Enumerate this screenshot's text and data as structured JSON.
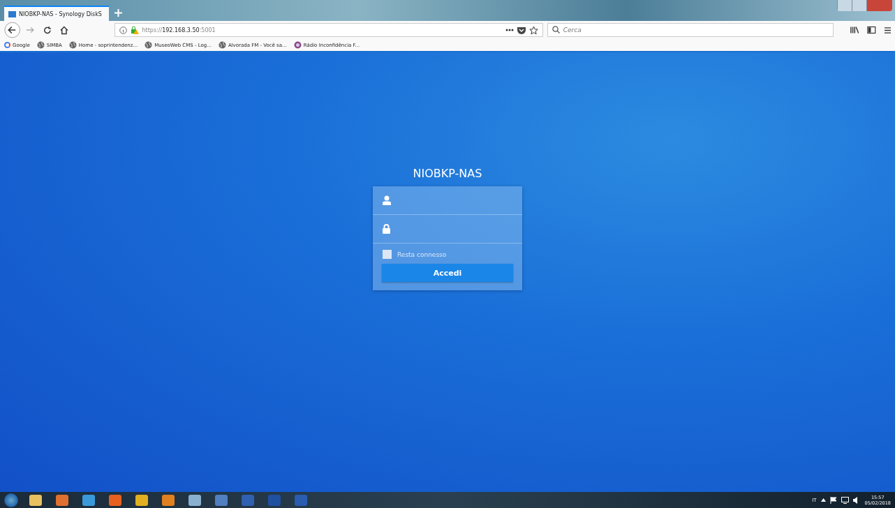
{
  "browser": {
    "tab": {
      "title": "NIOBKP-NAS - Synology DiskS",
      "selected": true
    },
    "address": {
      "scheme": "https://",
      "host": "192.168.3.50",
      "port": ":5001"
    },
    "search": {
      "placeholder": "Cerca"
    },
    "bookmarks": [
      {
        "label": "Google",
        "kind": "google"
      },
      {
        "label": "SIMBA",
        "kind": "globe"
      },
      {
        "label": "Home - soprintendenz...",
        "kind": "globe"
      },
      {
        "label": "MuseoWeb CMS - Log...",
        "kind": "globe"
      },
      {
        "label": "Alvorada FM - Você sa...",
        "kind": "globe"
      },
      {
        "label": "Rádio Inconfidência F...",
        "kind": "radio"
      }
    ]
  },
  "login": {
    "title": "NIOBKP-NAS",
    "remember": {
      "label": "Resta connesso",
      "checked": false
    },
    "button": "Accedi"
  },
  "taskbar": {
    "language": "IT",
    "time": "15:57",
    "date": "05/02/2018"
  }
}
